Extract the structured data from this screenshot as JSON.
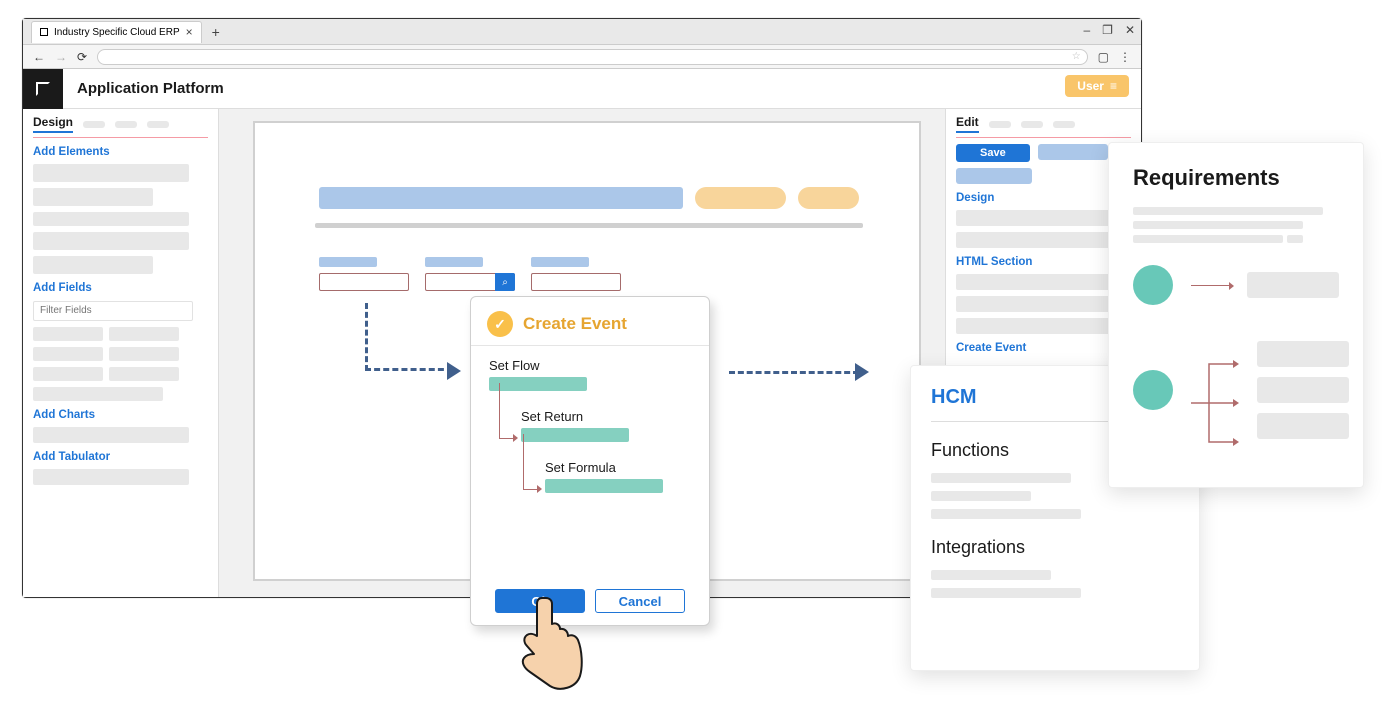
{
  "browser": {
    "tab_title": "Industry Specific Cloud ERP",
    "window_controls": {
      "minimize": "–",
      "maximize": "❐",
      "close": "✕"
    },
    "nav": {
      "back": "←",
      "forward": "→",
      "reload": "⟳"
    },
    "star": "☆",
    "menu": "⋮",
    "square": "▢"
  },
  "header": {
    "title": "Application Platform",
    "user_label": "User",
    "user_icon": "≡"
  },
  "left_panel": {
    "tab": "Design",
    "sections": {
      "add_elements": "Add Elements",
      "add_fields": "Add Fields",
      "filter_placeholder": "Filter Fields",
      "add_charts": "Add Charts",
      "add_tabulator": "Add Tabulator"
    }
  },
  "canvas": {
    "search_icon": "⌕"
  },
  "modal": {
    "title": "Create Event",
    "check": "✓",
    "steps": {
      "flow": "Set Flow",
      "ret": "Set Return",
      "formula": "Set Formula"
    },
    "buttons": {
      "ok": "Ok",
      "cancel": "Cancel"
    }
  },
  "right_panel": {
    "tab": "Edit",
    "save": "Save",
    "sections": {
      "design": "Design",
      "html": "HTML Section",
      "create_event": "Create Event"
    }
  },
  "hcm": {
    "title": "HCM",
    "functions": "Functions",
    "integrations": "Integrations"
  },
  "requirements": {
    "title": "Requirements"
  }
}
